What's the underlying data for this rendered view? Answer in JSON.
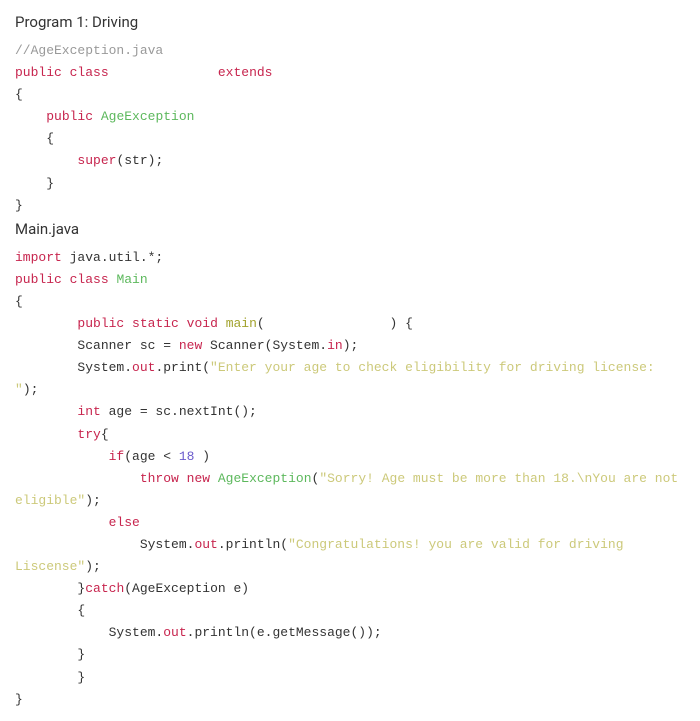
{
  "heading1": "Program 1: Driving",
  "heading2": "Main.java",
  "code1": {
    "comment": "//AgeException.java",
    "public": "public",
    "class": "class",
    "extends": "extends",
    "ageException": "AgeException",
    "superCall": "super",
    "strArg": "(str);"
  },
  "code2": {
    "import": "import",
    "javaUtil": " java.util.*;",
    "public": "public",
    "class": "class",
    "main": "Main",
    "static": "static",
    "void": "void",
    "mainFn": "main",
    "mainParen": "(                ) {",
    "scannerDecl1": "        Scanner sc = ",
    "new": "new",
    "scannerDecl2": " Scanner(System.",
    "in": "in",
    "scannerDecl3": ");",
    "sysOut": "System.",
    "out": "out",
    "print": ".print(",
    "str1": "\"Enter your age to check eligibility for driving license: \"",
    "closePrint": ");",
    "int": "int",
    "ageAssign": " age = sc.nextInt();",
    "try": "try",
    "tryBrace": "{",
    "if": "if",
    "ifCond1": "(age < ",
    "num18": "18",
    "ifCond2": " )",
    "throw": "throw",
    "new2": "new",
    "ageEx": "AgeException",
    "throwArg1": "(",
    "str2a": "\"Sorry! Age must be more than 18.\\nYou are not ",
    "str2b": "eligible\"",
    "throwArg2": ");",
    "else": "else",
    "println": ".println(",
    "str3": "\"Congratulations! you are valid for driving Liscense\"",
    "closePrintln": ");",
    "catch": "catch",
    "catchArg": "(AgeException e)",
    "getMsg": "(e.getMessage());"
  }
}
